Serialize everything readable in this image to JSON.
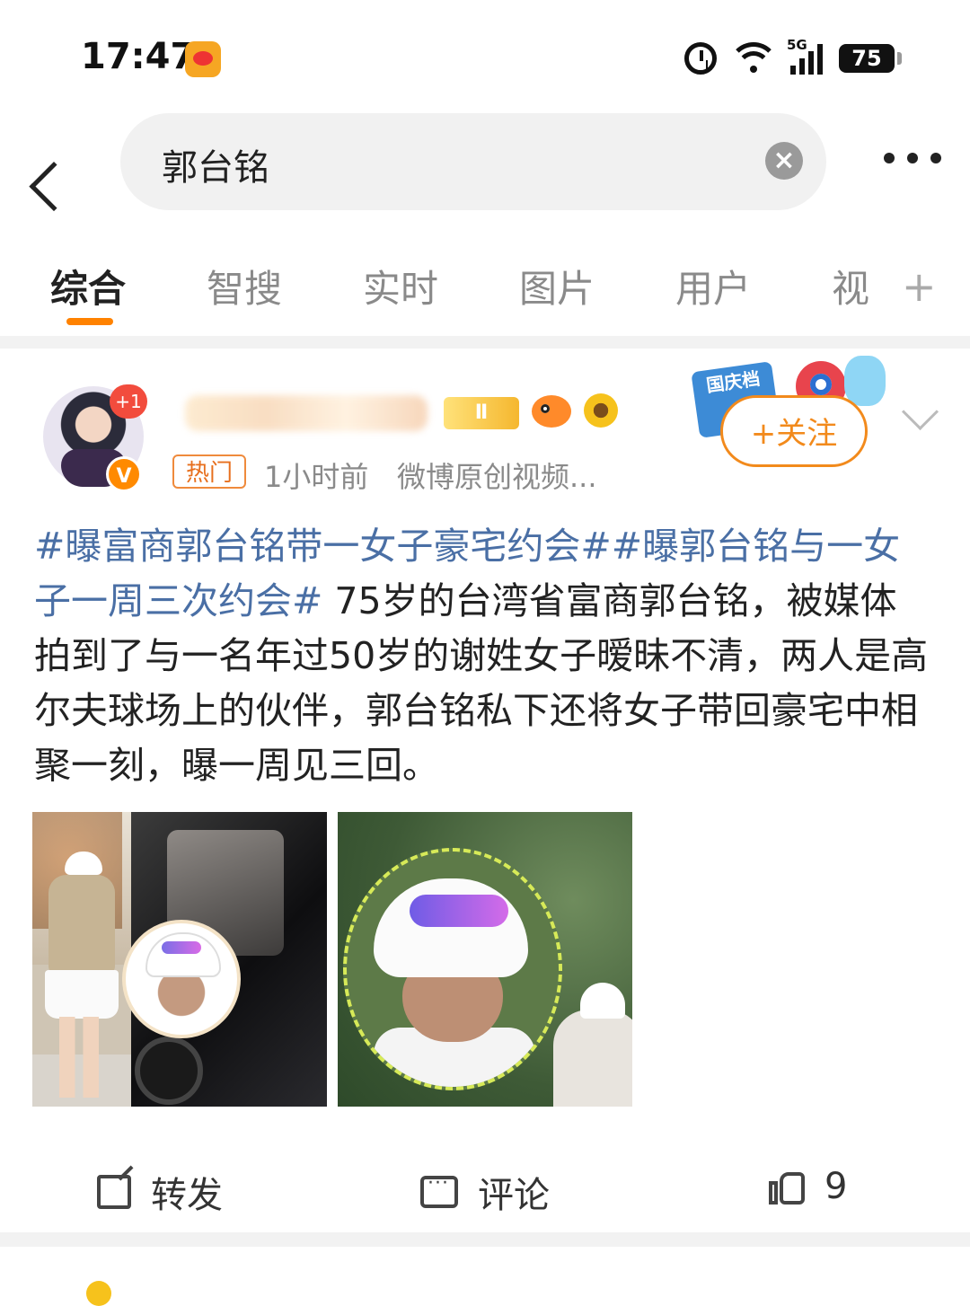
{
  "status_bar": {
    "time": "17:47",
    "network": "5G",
    "battery": "75",
    "icons": [
      "weibo-app-icon",
      "alarm-icon",
      "wifi-icon",
      "signal-icon",
      "battery-icon"
    ]
  },
  "search": {
    "query": "郭台铭",
    "clear_icon": "close-icon",
    "more_icon": "more-icon",
    "back_icon": "back-arrow-icon"
  },
  "tabs": [
    {
      "label": "综合",
      "active": true
    },
    {
      "label": "智搜",
      "active": false
    },
    {
      "label": "实时",
      "active": false
    },
    {
      "label": "图片",
      "active": false
    },
    {
      "label": "用户",
      "active": false
    },
    {
      "label": "视",
      "active": false
    }
  ],
  "tab_add": "+",
  "accent_color": "#ff8200",
  "post": {
    "avatar_badge": "+1",
    "verified_badge": "V",
    "hot_tag": "热门",
    "time": "1小时前",
    "source": "微博原创视频...",
    "follow_label": "+关注",
    "promo_label": "国庆档",
    "text": {
      "hashtag1": "#曝富商郭台铭带一女子豪宅约会#",
      "hashtag2": "#曝郭台铭与一女子一周三次约会#",
      "body": " 75岁的台湾省富商郭台铭，被媒体拍到了与一名年过50岁的谢姓女子暧昧不清，两人是高尔夫球场上的伙伴，郭台铭私下还将女子带回豪宅中相聚一刻，曝一周见三回。"
    },
    "link_color": "#4a6fa5"
  },
  "actions": {
    "repost": "转发",
    "comment": "评论",
    "like_count": "9"
  }
}
